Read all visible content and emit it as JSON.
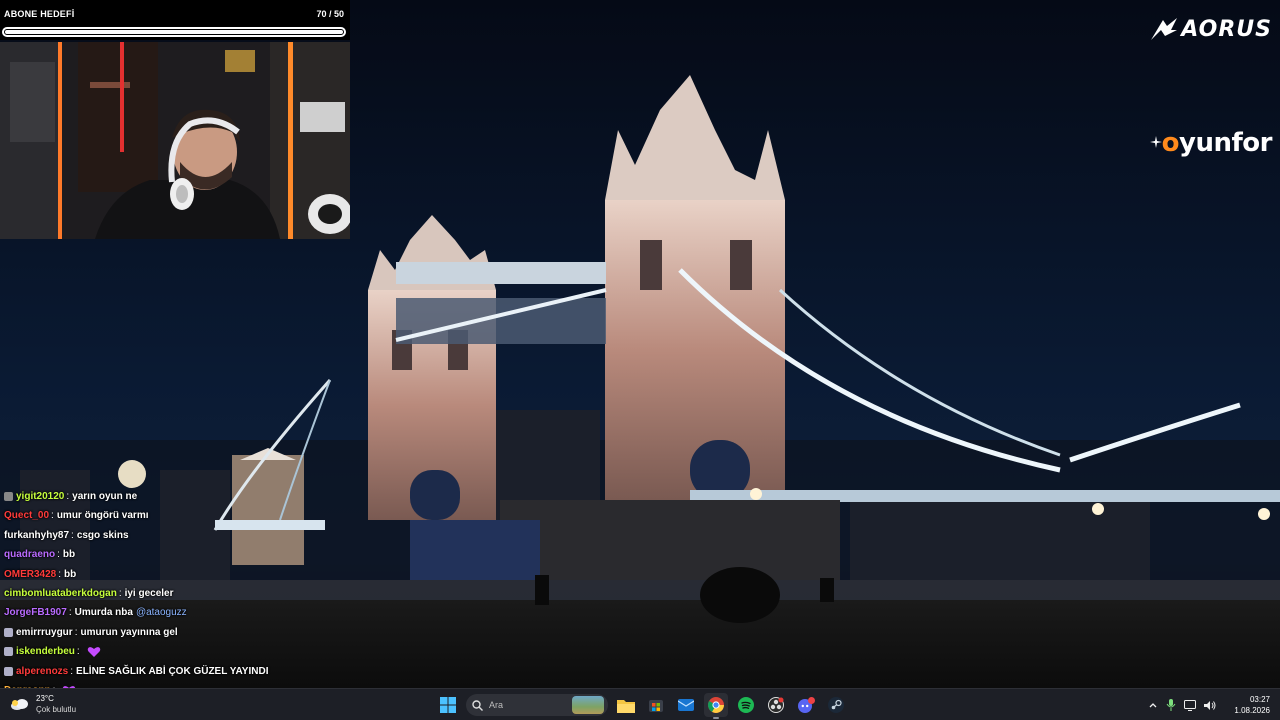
{
  "overlay": {
    "sub_goal": {
      "label": "ABONE HEDEFİ",
      "count_text": "70 / 50",
      "progress_fraction": 1.0
    },
    "brand_logos": [
      "AORUS",
      "oyunfor"
    ]
  },
  "chat": [
    {
      "user": "yigit20120",
      "user_color": "#c6ff3d",
      "message": "yarın oyun ne",
      "badge": "hourglass"
    },
    {
      "user": "Quect_00",
      "user_color": "#ff3b3b",
      "message": "umur öngörü varmı",
      "badge": "none"
    },
    {
      "user": "furkanhyhy87",
      "user_color": "#ffffff",
      "message": "csgo skins",
      "badge": "none"
    },
    {
      "user": "quadraeno",
      "user_color": "#b96bff",
      "message": "bb",
      "badge": "none"
    },
    {
      "user": "OMER3428",
      "user_color": "#ff3b3b",
      "message": "bb",
      "badge": "none"
    },
    {
      "user": "cimbomluataberkdogan",
      "user_color": "#c6ff3d",
      "message": "iyi geceler",
      "badge": "none"
    },
    {
      "user": "JorgeFB1907",
      "user_color": "#b96bff",
      "message": "Umurda nba",
      "mention": "@ataoguzz",
      "badge": "none"
    },
    {
      "user": "emirrruygur",
      "user_color": "#ffffff",
      "message": "umurun yayınına gel",
      "badge": "sub"
    },
    {
      "user": "iskenderbeu",
      "user_color": "#c6ff3d",
      "message": "",
      "emote": "heart",
      "badge": "sub"
    },
    {
      "user": "alperenozs",
      "user_color": "#ff3b3b",
      "message": "ELİNE SAĞLIK ABİ ÇOK GÜZEL YAYINDI",
      "badge": "sub"
    },
    {
      "user": "Denreonn",
      "user_color": "#ffb23d",
      "message": "",
      "emote": "heart",
      "badge": "none"
    }
  ],
  "taskbar": {
    "weather": {
      "temp": "23°C",
      "condition": "Çok bulutlu",
      "icon": "cloud-icon"
    },
    "search_placeholder": "Ara",
    "apps": [
      "windows-start-icon",
      "file-explorer-icon",
      "store-icon",
      "mail-icon",
      "chrome-icon",
      "spotify-icon",
      "obs-icon",
      "discord-icon",
      "steam-icon"
    ],
    "discord_badge": "9+",
    "time": "03:27",
    "date": "1.08.2026"
  },
  "colors": {
    "taskbar_bg": "#1d1f26",
    "oyunfor_accent": "#ff8a1c"
  }
}
